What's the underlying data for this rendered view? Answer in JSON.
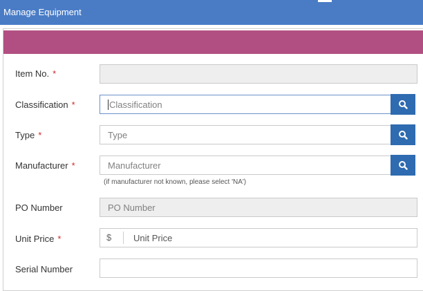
{
  "window": {
    "title": "Manage Equipment"
  },
  "form": {
    "required_mark": "*",
    "item_no": {
      "label": "Item No.",
      "required": true,
      "value": ""
    },
    "classification": {
      "label": "Classification",
      "required": true,
      "placeholder": "Classification"
    },
    "type": {
      "label": "Type",
      "required": true,
      "placeholder": "Type"
    },
    "manufacturer": {
      "label": "Manufacturer",
      "required": true,
      "placeholder": "Manufacturer",
      "hint": "(if manufacturer not known, please select 'NA')"
    },
    "po_number": {
      "label": "PO Number",
      "required": false,
      "placeholder": "PO Number"
    },
    "unit_price": {
      "label": "Unit Price",
      "required": true,
      "currency_symbol": "$",
      "placeholder": "Unit Price"
    },
    "serial_number": {
      "label": "Serial Number",
      "required": false,
      "value": ""
    }
  },
  "icons": {
    "search": "search-icon"
  },
  "colors": {
    "titlebar": "#4a7cc6",
    "band": "#b24f82",
    "search_button": "#2e6bb0",
    "required": "#d12a2a"
  }
}
